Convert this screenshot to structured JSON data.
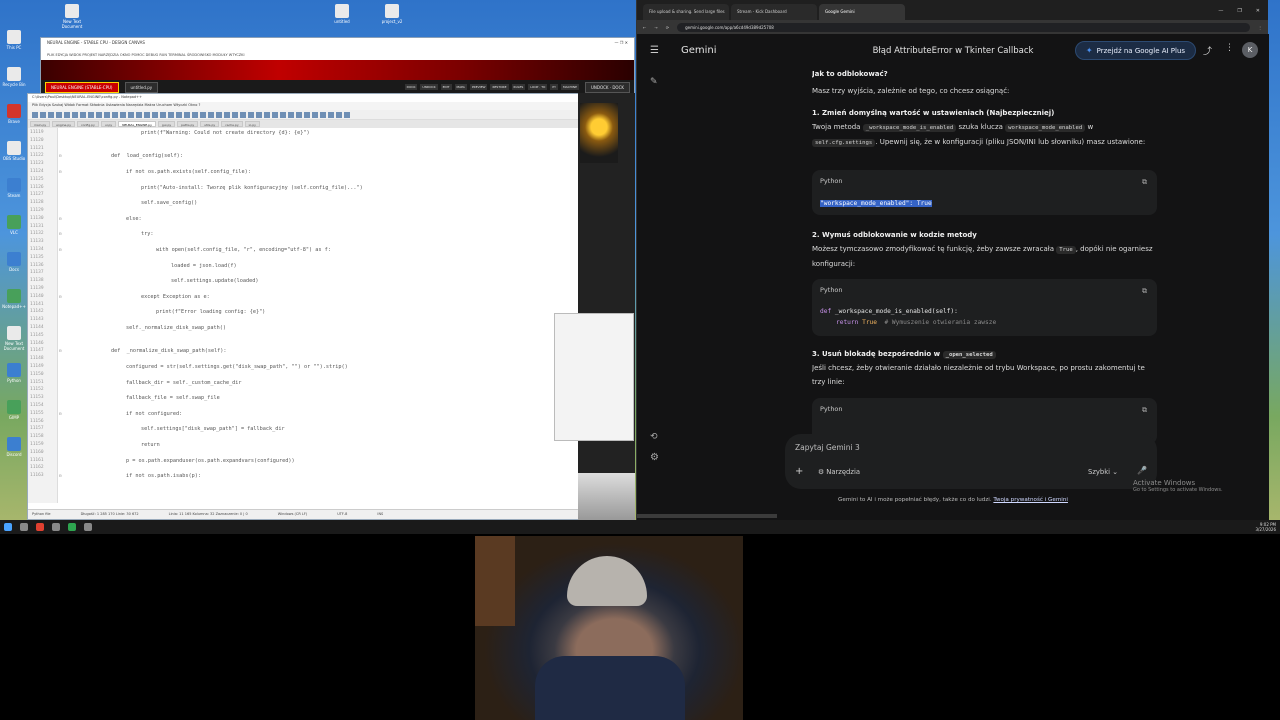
{
  "desktop": {
    "icons": [
      {
        "label": "This PC"
      },
      {
        "label": "Recycle Bin"
      },
      {
        "label": "Brave"
      },
      {
        "label": "OBS Studio"
      },
      {
        "label": "Steam"
      },
      {
        "label": "VLC"
      },
      {
        "label": "Docs"
      },
      {
        "label": "Notepad++"
      },
      {
        "label": "New Text Document"
      },
      {
        "label": "Python"
      },
      {
        "label": "GIMP"
      },
      {
        "label": "Discord"
      }
    ],
    "top_icons": [
      {
        "label": "New Text Document"
      },
      {
        "label": "untitled"
      },
      {
        "label": "project_v2"
      }
    ]
  },
  "editor_window": {
    "title": "NEURAL ENGINE - STABLE CPU - DESIGN CANVAS",
    "menu": "PLIK  EDYCJA  WIDOK  PROJEKT  NARZĘDZIA  OKNO  POMOC  DEBUG  RUN  TERMINAL  ŚRODOWISKO  MODUŁY  WTYCZKI",
    "engine_label": "NEURAL ENGINE (STABLE-CPU)",
    "file_tab": "untitled.py",
    "mode_tab": "UNDOCK · DOCK",
    "mini_tabs": [
      "DOCK",
      "UNDOCK",
      "EDIT",
      "MAPA",
      "PREVIEW",
      "RESTORE",
      "RULES",
      "LOOP · TO",
      "PY",
      "MACHINE"
    ]
  },
  "npp": {
    "title": "C:\\Users\\Paul\\Desktop\\NEURAL-ENGINE\\config.py - Notepad++",
    "menu": "Plik  Edycja  Szukaj  Widok  Format  Składnia  Ustawienia  Narzędzia  Makra  Uruchom  Wtyczki  Okno  ?",
    "tabs": [
      "main.py",
      "engine.py",
      "config.py",
      "ui.py",
      "NEURAL_ENGINE.py",
      "gui.py",
      "paths.py",
      "utils.py",
      "cache.py",
      "io.py"
    ],
    "active_tab": "NEURAL_ENGINE.py",
    "lines": [
      {
        "n": "11119",
        "indent": 5,
        "text": "print(f\"Warning: Could not create directory {d}: {e}\")",
        "fold": false
      },
      {
        "n": "11120",
        "indent": 0,
        "text": "",
        "fold": false
      },
      {
        "n": "11121",
        "indent": 0,
        "text": "",
        "fold": false
      },
      {
        "n": "11122",
        "indent": 3,
        "text": "def  load_config(self):",
        "fold": true
      },
      {
        "n": "11123",
        "indent": 0,
        "text": "",
        "fold": false
      },
      {
        "n": "11124",
        "indent": 4,
        "text": "if not os.path.exists(self.config_file):",
        "fold": true
      },
      {
        "n": "11125",
        "indent": 0,
        "text": "",
        "fold": false
      },
      {
        "n": "11126",
        "indent": 5,
        "text": "print(\"Auto-install: Tworzę plik konfiguracyjny (self.config_file)...\")",
        "fold": false
      },
      {
        "n": "11127",
        "indent": 0,
        "text": "",
        "fold": false
      },
      {
        "n": "11128",
        "indent": 5,
        "text": "self.save_config()",
        "fold": false
      },
      {
        "n": "11129",
        "indent": 0,
        "text": "",
        "fold": false
      },
      {
        "n": "11130",
        "indent": 4,
        "text": "else:",
        "fold": true
      },
      {
        "n": "11131",
        "indent": 0,
        "text": "",
        "fold": false
      },
      {
        "n": "11132",
        "indent": 5,
        "text": "try:",
        "fold": true
      },
      {
        "n": "11133",
        "indent": 0,
        "text": "",
        "fold": false
      },
      {
        "n": "11134",
        "indent": 6,
        "text": "with open(self.config_file, \"r\", encoding=\"utf-8\") as f:",
        "fold": true
      },
      {
        "n": "11135",
        "indent": 0,
        "text": "",
        "fold": false
      },
      {
        "n": "11136",
        "indent": 7,
        "text": "loaded = json.load(f)",
        "fold": false
      },
      {
        "n": "11137",
        "indent": 0,
        "text": "",
        "fold": false
      },
      {
        "n": "11138",
        "indent": 7,
        "text": "self.settings.update(loaded)",
        "fold": false
      },
      {
        "n": "11139",
        "indent": 0,
        "text": "",
        "fold": false
      },
      {
        "n": "11140",
        "indent": 5,
        "text": "except Exception as e:",
        "fold": true
      },
      {
        "n": "11141",
        "indent": 0,
        "text": "",
        "fold": false
      },
      {
        "n": "11142",
        "indent": 6,
        "text": "print(f\"Error loading config: {e}\")",
        "fold": false
      },
      {
        "n": "11143",
        "indent": 0,
        "text": "",
        "fold": false
      },
      {
        "n": "11144",
        "indent": 4,
        "text": "self._normalize_disk_swap_path()",
        "fold": false
      },
      {
        "n": "11145",
        "indent": 0,
        "text": "",
        "fold": false
      },
      {
        "n": "11146",
        "indent": 0,
        "text": "",
        "fold": false
      },
      {
        "n": "11147",
        "indent": 3,
        "text": "def  _normalize_disk_swap_path(self):",
        "fold": true
      },
      {
        "n": "11148",
        "indent": 0,
        "text": "",
        "fold": false
      },
      {
        "n": "11149",
        "indent": 4,
        "text": "configured = str(self.settings.get(\"disk_swap_path\", \"\") or \"\").strip()",
        "fold": false
      },
      {
        "n": "11150",
        "indent": 0,
        "text": "",
        "fold": false
      },
      {
        "n": "11151",
        "indent": 4,
        "text": "fallback_dir = self._custom_cache_dir",
        "fold": false
      },
      {
        "n": "11152",
        "indent": 0,
        "text": "",
        "fold": false
      },
      {
        "n": "11153",
        "indent": 4,
        "text": "fallback_file = self.swap_file",
        "fold": false
      },
      {
        "n": "11154",
        "indent": 0,
        "text": "",
        "fold": false
      },
      {
        "n": "11155",
        "indent": 4,
        "text": "if not configured:",
        "fold": true
      },
      {
        "n": "11156",
        "indent": 0,
        "text": "",
        "fold": false
      },
      {
        "n": "11157",
        "indent": 5,
        "text": "self.settings[\"disk_swap_path\"] = fallback_dir",
        "fold": false
      },
      {
        "n": "11158",
        "indent": 0,
        "text": "",
        "fold": false
      },
      {
        "n": "11159",
        "indent": 5,
        "text": "return",
        "fold": false
      },
      {
        "n": "11160",
        "indent": 0,
        "text": "",
        "fold": false
      },
      {
        "n": "11161",
        "indent": 4,
        "text": "p = os.path.expanduser(os.path.expandvars(configured))",
        "fold": false
      },
      {
        "n": "11162",
        "indent": 0,
        "text": "",
        "fold": false
      },
      {
        "n": "11163",
        "indent": 4,
        "text": "if not os.path.isabs(p):",
        "fold": true
      }
    ],
    "status": [
      "Python file",
      "Długość: 1 285 170   Linie: 30 672",
      "Linia: 11 165   Kolumna: 32   Zaznaczenie: 0 | 0",
      "Windows (CR LF)",
      "UTF-8",
      "INS"
    ]
  },
  "browser": {
    "tabs": [
      {
        "label": "File upload & sharing. Send large files",
        "active": false
      },
      {
        "label": "Stream - Kick Dashboard",
        "active": false
      },
      {
        "label": "Google Gemini",
        "active": true
      }
    ],
    "url": "gemini.google.com/app/a6cd49d389d25708",
    "window_controls": [
      "—",
      "❐",
      "✕"
    ]
  },
  "gemini": {
    "brand": "Gemini",
    "conversation_title": "Błąd AttributeError w Tkinter Callback",
    "upgrade_label": "Przejdź na Google AI Plus",
    "avatar_letter": "K",
    "section_heading": "Jak to odblokować?",
    "intro": "Masz trzy wyjścia, zależnie od tego, co chcesz osiągnąć:",
    "step1": {
      "title": "1. Zmień domyślną wartość w ustawieniach (Najbezpieczniej)",
      "text_a": "Twoja metoda ",
      "code_a": "_workspace_mode_is_enabled",
      "text_b": " szuka klucza ",
      "code_b": "workspace_mode_enabled",
      "text_c": " w",
      "code_c": "self.cfg.settings",
      "text_d": ". Upewnij się, że w konfiguracji (pliku JSON/INI lub słowniku) masz ustawione:"
    },
    "code1": {
      "lang": "Python",
      "key": "\"workspace_mode_enabled\"",
      "sep": ": ",
      "value": "True"
    },
    "step2": {
      "title": "2. Wymuś odblokowanie w kodzie metody",
      "text_a": "Możesz tymczasowo zmodyfikować tę funkcję, żeby zawsze zwracała ",
      "code_a": "True",
      "text_b": ", dopóki nie ogarniesz konfiguracji:"
    },
    "code2": {
      "lang": "Python",
      "def_kw": "def",
      "def_sig": " _workspace_mode_is_enabled(self):",
      "ret_kw": "return",
      "ret_val": "True",
      "comment": "# Wymuszenie otwierania zawsze"
    },
    "step3": {
      "title_a": "3. Usuń blokadę bezpośrednio w ",
      "title_code": "_open_selected",
      "text": "Jeśli chcesz, żeby otwieranie działało niezależnie od trybu Workspace, po prostu zakomentuj te trzy linie:"
    },
    "code3": {
      "lang": "Python"
    },
    "prompt_placeholder": "Zapytaj Gemini 3",
    "tools_label": "Narzędzia",
    "speed_label": "Szybki",
    "disclaimer_text": "Gemini to AI i może popełniać błędy, także co do ludzi. ",
    "disclaimer_link": "Twoja prywatność i Gemini",
    "activate_title": "Activate Windows",
    "activate_sub": "Go to Settings to activate Windows."
  },
  "taskbar": {
    "time": "9:02 PM",
    "date": "3/27/2026"
  },
  "icons": {
    "hamburger": "☰",
    "new_chat": "✎",
    "history": "⟲",
    "settings": "⚙",
    "share": "⤴",
    "kebab": "⋮",
    "copy": "⧉",
    "add": "+",
    "tools": "⚙",
    "chevron": "⌄",
    "mic": "🎤",
    "spark": "✦"
  },
  "colors": {
    "gemini_bg": "#131314",
    "selection": "#3563c6",
    "upgrade_btn": "#1c2c44",
    "banner_red": "#c00000"
  }
}
